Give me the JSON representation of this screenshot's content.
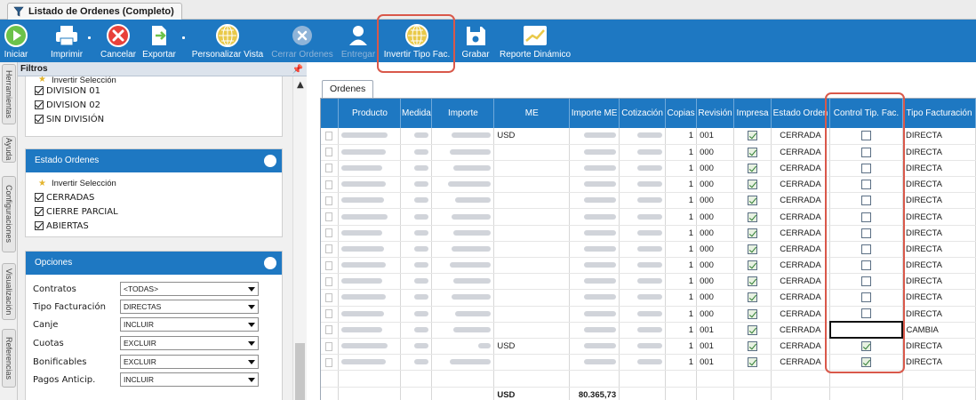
{
  "window": {
    "title": "Listado de Ordenes (Completo)",
    "icon": "funnel-icon"
  },
  "toolbar": {
    "iniciar": "Iniciar",
    "imprimir": "Imprimir",
    "cancelar": "Cancelar",
    "exportar": "Exportar",
    "personalizar": "Personalizar Vista",
    "cerrar": "Cerrar Ordenes",
    "entregar": "Entregar",
    "invertir": "Invertir Tipo Fac.",
    "grabar": "Grabar",
    "reporte": "Reporte Dinámico"
  },
  "side_tabs": [
    "Herramientas",
    "Ayuda",
    "Configuraciones",
    "Visualización",
    "Referencias"
  ],
  "filters": {
    "title": "Filtros",
    "pin": "p",
    "divisions": {
      "invert_label": "Invertir Selección",
      "items": [
        "DIVISION 01",
        "DIVISION 02",
        "SIN DIVISIÓN"
      ]
    },
    "estado": {
      "title": "Estado Ordenes",
      "invert_label": "Invertir Selección",
      "items": [
        "CERRADAS",
        "CIERRE PARCIAL",
        "ABIERTAS"
      ]
    },
    "opciones": {
      "title": "Opciones",
      "rows": [
        {
          "label": "Contratos",
          "value": "<TODAS>"
        },
        {
          "label": "Tipo Facturación",
          "value": "DIRECTAS"
        },
        {
          "label": "Canje",
          "value": "INCLUIR"
        },
        {
          "label": "Cuotas",
          "value": "EXCLUIR"
        },
        {
          "label": "Bonificables",
          "value": "EXCLUIR"
        },
        {
          "label": "Pagos Anticip.",
          "value": "INCLUIR"
        }
      ]
    }
  },
  "grid": {
    "tab": "Ordenes",
    "columns": [
      "Producto",
      "Medida",
      "Importe",
      "ME",
      "Importe ME",
      "Cotización",
      "Copias",
      "Revisión",
      "Impresa",
      "Estado Orden",
      "Control Tip. Fac.",
      "Tipo Facturación"
    ],
    "rows": [
      {
        "me": "USD",
        "copias": "1",
        "revision": "001",
        "impresa": true,
        "estado": "CERRADA",
        "control": false,
        "tipo": "DIRECTA"
      },
      {
        "me": "",
        "copias": "1",
        "revision": "000",
        "impresa": true,
        "estado": "CERRADA",
        "control": false,
        "tipo": "DIRECTA"
      },
      {
        "me": "",
        "copias": "1",
        "revision": "000",
        "impresa": true,
        "estado": "CERRADA",
        "control": false,
        "tipo": "DIRECTA"
      },
      {
        "me": "",
        "copias": "1",
        "revision": "000",
        "impresa": true,
        "estado": "CERRADA",
        "control": false,
        "tipo": "DIRECTA"
      },
      {
        "me": "",
        "copias": "1",
        "revision": "000",
        "impresa": true,
        "estado": "CERRADA",
        "control": false,
        "tipo": "DIRECTA"
      },
      {
        "me": "",
        "copias": "1",
        "revision": "000",
        "impresa": true,
        "estado": "CERRADA",
        "control": false,
        "tipo": "DIRECTA"
      },
      {
        "me": "",
        "copias": "1",
        "revision": "000",
        "impresa": true,
        "estado": "CERRADA",
        "control": false,
        "tipo": "DIRECTA"
      },
      {
        "me": "",
        "copias": "1",
        "revision": "000",
        "impresa": true,
        "estado": "CERRADA",
        "control": false,
        "tipo": "DIRECTA"
      },
      {
        "me": "",
        "copias": "1",
        "revision": "000",
        "impresa": true,
        "estado": "CERRADA",
        "control": false,
        "tipo": "DIRECTA"
      },
      {
        "me": "",
        "copias": "1",
        "revision": "000",
        "impresa": true,
        "estado": "CERRADA",
        "control": false,
        "tipo": "DIRECTA"
      },
      {
        "me": "",
        "copias": "1",
        "revision": "000",
        "impresa": true,
        "estado": "CERRADA",
        "control": false,
        "tipo": "DIRECTA"
      },
      {
        "me": "",
        "copias": "1",
        "revision": "000",
        "impresa": true,
        "estado": "CERRADA",
        "control": false,
        "tipo": "DIRECTA"
      },
      {
        "me": "",
        "copias": "1",
        "revision": "001",
        "impresa": true,
        "estado": "CERRADA",
        "control": null,
        "tipo": "CAMBIA"
      },
      {
        "me": "USD",
        "copias": "1",
        "revision": "001",
        "impresa": true,
        "estado": "CERRADA",
        "control": true,
        "tipo": "DIRECTA"
      },
      {
        "me": "",
        "copias": "1",
        "revision": "001",
        "impresa": true,
        "estado": "CERRADA",
        "control": true,
        "tipo": "DIRECTA"
      }
    ],
    "total": {
      "me": "USD",
      "importe_me": "80.365,73"
    }
  },
  "colors": {
    "accent": "#1e78c2",
    "highlight": "#d9584a",
    "check_green": "#2e7d32"
  }
}
